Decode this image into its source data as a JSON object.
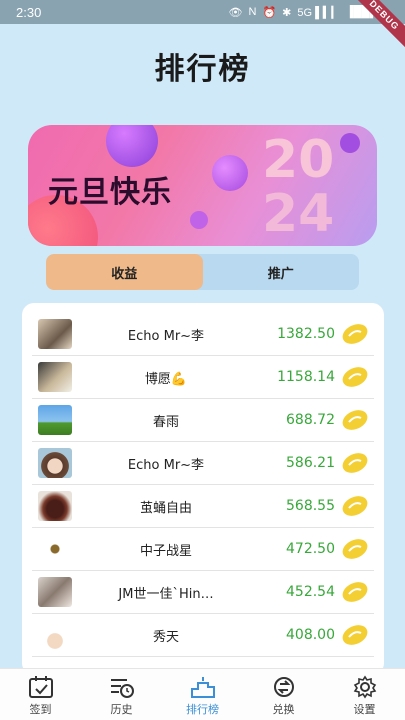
{
  "status_bar": {
    "time": "2:30",
    "battery": "▐██▌",
    "signal": "5G ▌▍▎"
  },
  "debug_label": "DEBUG",
  "page_title": "排行榜",
  "banner": {
    "text": "元旦快乐",
    "year_top": "20",
    "year_bottom": "24"
  },
  "tabs": [
    {
      "label": "收益",
      "active": true
    },
    {
      "label": "推广",
      "active": false
    }
  ],
  "rows": [
    {
      "name": "Echo Mr~李",
      "value": "1382.50",
      "avatar": "photo-avatar-1"
    },
    {
      "name": "博愿💪",
      "value": "1158.14",
      "avatar": "photo-avatar-2"
    },
    {
      "name": "春雨",
      "value": "688.72",
      "avatar": "landscape-avatar"
    },
    {
      "name": "Echo Mr~李",
      "value": "586.21",
      "avatar": "cartoon-girl-avatar"
    },
    {
      "name": "茧蛹自由",
      "value": "568.55",
      "avatar": "food-avatar"
    },
    {
      "name": "中子战星",
      "value": "472.50",
      "avatar": "small-icon-avatar"
    },
    {
      "name": "JM世一佳`Hin…",
      "value": "452.54",
      "avatar": "anime-avatar"
    },
    {
      "name": "秀天",
      "value": "408.00",
      "avatar": "cartoon-hat-avatar"
    }
  ],
  "nav": [
    {
      "label": "签到",
      "icon": "calendar-check-icon",
      "active": false
    },
    {
      "label": "历史",
      "icon": "history-icon",
      "active": false
    },
    {
      "label": "排行榜",
      "icon": "podium-icon",
      "active": true
    },
    {
      "label": "兑换",
      "icon": "exchange-icon",
      "active": false
    },
    {
      "label": "设置",
      "icon": "gear-icon",
      "active": false
    }
  ],
  "colors": {
    "accent": "#3a8fd6",
    "value_green": "#38a83a",
    "active_tab": "#efb98a",
    "background": "#cfe9f8"
  }
}
